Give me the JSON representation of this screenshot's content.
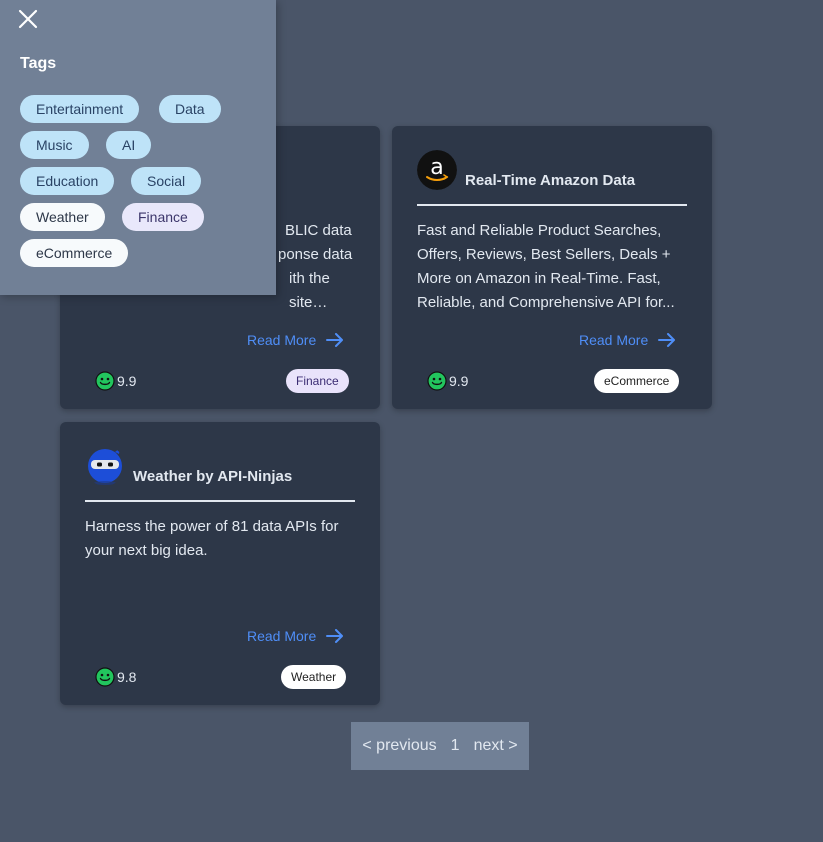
{
  "cards": [
    {
      "title": "",
      "description": "...BLIC data ...ponse data ...ith the site at request time. You are going to ge...",
      "read_more": "Read More",
      "rating": "9.9",
      "tag": "Finance"
    },
    {
      "title": "Real-Time Amazon Data",
      "description": "Fast and Reliable Product Searches, Offers, Reviews, Best Sellers, Deals + More on Amazon in Real-Time. Fast, Reliable, and Comprehensive API for...",
      "read_more": "Read More",
      "rating": "9.9",
      "tag": "eCommerce",
      "logo_icon": "amazon-logo"
    },
    {
      "title": "Weather by API-Ninjas",
      "description": "Harness the power of 81 data APIs for your next big idea.",
      "read_more": "Read More",
      "rating": "9.8",
      "tag": "Weather",
      "logo_icon": "ninja-logo"
    }
  ],
  "pagination": {
    "previous": "< previous",
    "page": "1",
    "next": "next >"
  },
  "tags_panel": {
    "title": "Tags",
    "close_icon": "close-icon",
    "tags": [
      "Entertainment",
      "Data",
      "Music",
      "AI",
      "Education",
      "Social",
      "Weather",
      "Finance",
      "eCommerce"
    ]
  },
  "colors": {
    "background": "#4a5568",
    "card": "#2d3748",
    "panel": "#718096",
    "link": "#4f8ef7",
    "tag_blue": "#bee3f8",
    "tag_lavender": "#e9e8fb",
    "rating_green": "#22c55e"
  }
}
